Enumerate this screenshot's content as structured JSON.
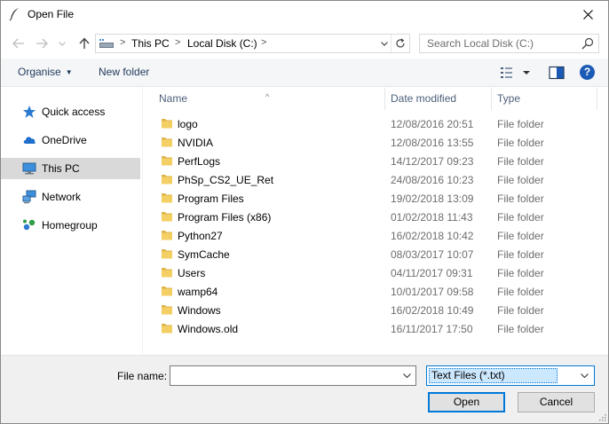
{
  "window": {
    "title": "Open File"
  },
  "nav": {
    "back_icon": "arrow-left-icon",
    "forward_icon": "arrow-right-icon",
    "recent_icon": "chevron-down-icon",
    "up_icon": "arrow-up-icon"
  },
  "address": {
    "crumbs": [
      "This PC",
      "Local Disk (C:)"
    ],
    "separator": ">"
  },
  "search": {
    "placeholder": "Search Local Disk (C:)"
  },
  "toolbar": {
    "organise_label": "Organise",
    "new_folder_label": "New folder",
    "help_label": "?"
  },
  "sidebar": {
    "items": [
      {
        "label": "Quick access",
        "icon": "star-icon",
        "selected": false
      },
      {
        "label": "OneDrive",
        "icon": "cloud-icon",
        "selected": false
      },
      {
        "label": "This PC",
        "icon": "computer-icon",
        "selected": true
      },
      {
        "label": "Network",
        "icon": "network-icon",
        "selected": false
      },
      {
        "label": "Homegroup",
        "icon": "homegroup-icon",
        "selected": false
      }
    ]
  },
  "columns": {
    "name": "Name",
    "date": "Date modified",
    "type": "Type"
  },
  "files": [
    {
      "name": "logo",
      "date": "12/08/2016 20:51",
      "type": "File folder"
    },
    {
      "name": "NVIDIA",
      "date": "12/08/2016 13:55",
      "type": "File folder"
    },
    {
      "name": "PerfLogs",
      "date": "14/12/2017 09:23",
      "type": "File folder"
    },
    {
      "name": "PhSp_CS2_UE_Ret",
      "date": "24/08/2016 10:23",
      "type": "File folder"
    },
    {
      "name": "Program Files",
      "date": "19/02/2018 13:09",
      "type": "File folder"
    },
    {
      "name": "Program Files (x86)",
      "date": "01/02/2018 11:43",
      "type": "File folder"
    },
    {
      "name": "Python27",
      "date": "16/02/2018 10:42",
      "type": "File folder"
    },
    {
      "name": "SymCache",
      "date": "08/03/2017 10:07",
      "type": "File folder"
    },
    {
      "name": "Users",
      "date": "04/11/2017 09:31",
      "type": "File folder"
    },
    {
      "name": "wamp64",
      "date": "10/01/2017 09:58",
      "type": "File folder"
    },
    {
      "name": "Windows",
      "date": "16/02/2018 10:49",
      "type": "File folder"
    },
    {
      "name": "Windows.old",
      "date": "16/11/2017 17:50",
      "type": "File folder"
    }
  ],
  "footer": {
    "file_name_label": "File name:",
    "file_name_value": "",
    "file_type": "Text Files (*.txt)",
    "open_label": "Open",
    "cancel_label": "Cancel"
  },
  "colors": {
    "accent": "#0078d7",
    "folder": "#f4cf63",
    "selected_bg": "#d9d9d9",
    "toolbar_text": "#1e395b"
  }
}
